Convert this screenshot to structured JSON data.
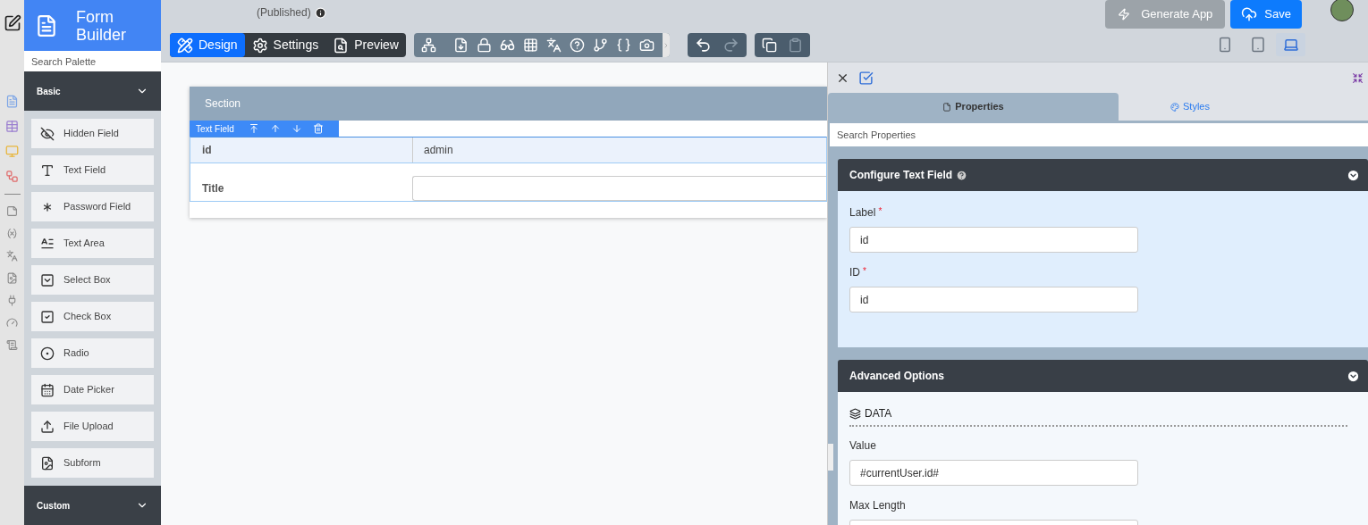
{
  "app": {
    "title": "Form Builder"
  },
  "palette": {
    "search_placeholder": "Search Palette",
    "groups": [
      {
        "name": "Basic",
        "expanded": true,
        "items": [
          {
            "kind": "hidden",
            "label": "Hidden Field"
          },
          {
            "kind": "text",
            "label": "Text Field"
          },
          {
            "kind": "password",
            "label": "Password Field"
          },
          {
            "kind": "textarea",
            "label": "Text Area"
          },
          {
            "kind": "select",
            "label": "Select Box"
          },
          {
            "kind": "checkbox",
            "label": "Check Box"
          },
          {
            "kind": "radio",
            "label": "Radio"
          },
          {
            "kind": "date",
            "label": "Date Picker"
          },
          {
            "kind": "file",
            "label": "File Upload"
          },
          {
            "kind": "subform",
            "label": "Subform"
          }
        ]
      },
      {
        "name": "Custom",
        "expanded": true
      }
    ]
  },
  "header": {
    "status": "(Published)",
    "mode_tabs": [
      {
        "label": "Design",
        "selected": true
      },
      {
        "label": "Settings",
        "selected": false
      },
      {
        "label": "Preview",
        "selected": false
      }
    ],
    "history": [
      {
        "kind": "undo",
        "disabled": false
      },
      {
        "kind": "redo",
        "disabled": true
      }
    ],
    "clipboard": [
      {
        "kind": "copy",
        "disabled": false
      },
      {
        "kind": "paste",
        "disabled": true
      }
    ],
    "generate_button": "Generate App",
    "save_button": "Save",
    "devices": [
      {
        "kind": "phone",
        "selected": false
      },
      {
        "kind": "tablet",
        "selected": false
      },
      {
        "kind": "laptop",
        "selected": true
      }
    ]
  },
  "canvas": {
    "section_title": "Section",
    "toolbar_label": "Text Field",
    "fields": [
      {
        "label": "id",
        "value": "admin",
        "selected": true
      },
      {
        "label": "Title",
        "selected": false
      }
    ]
  },
  "properties": {
    "tabs": [
      {
        "label": "Properties",
        "selected": true
      },
      {
        "label": "Styles",
        "selected": false
      }
    ],
    "search_placeholder": "Search Properties",
    "panels": [
      {
        "title": "Configure Text Field",
        "help": true,
        "expanded": true,
        "fields": [
          {
            "label": "Label",
            "required_mark": "*",
            "value": "id"
          },
          {
            "label": "ID",
            "required_mark": "*",
            "value": "id"
          }
        ]
      },
      {
        "title": "Advanced Options",
        "help": false,
        "expanded": true,
        "subheading": "DATA",
        "fields": [
          {
            "label": "Value",
            "value": "#currentUser.id#"
          },
          {
            "label": "Max Length"
          }
        ]
      }
    ]
  }
}
